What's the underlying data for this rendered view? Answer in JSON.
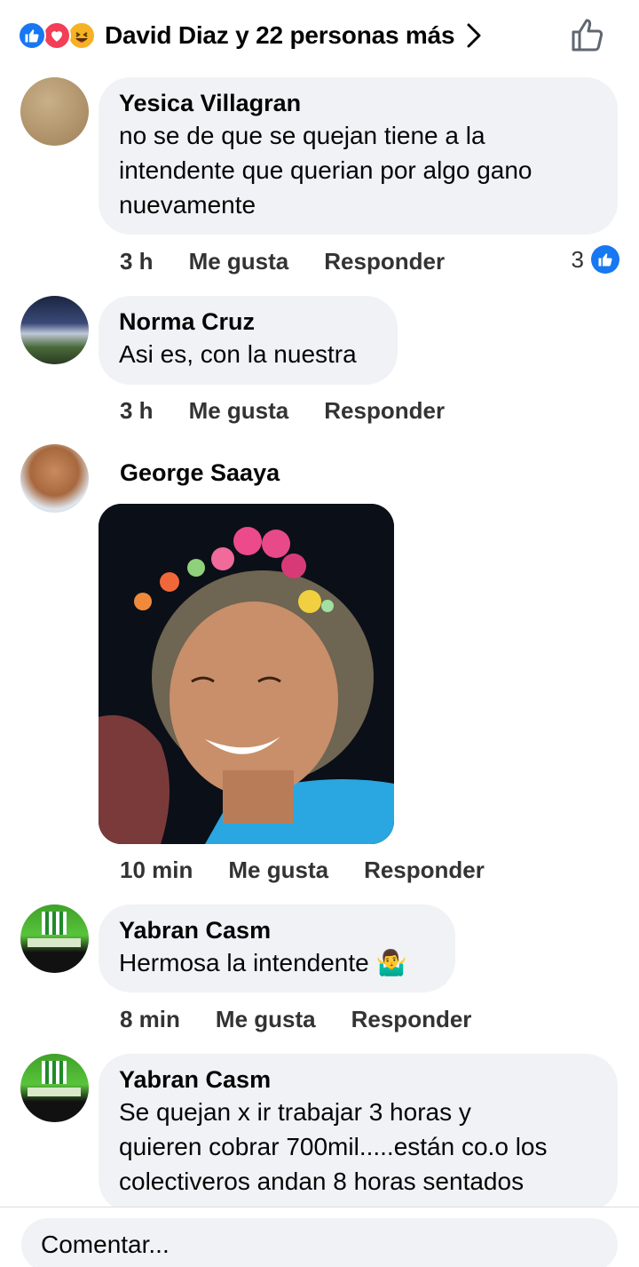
{
  "header": {
    "reactions_summary": "David Diaz y 22 personas más",
    "reaction_types": [
      "like-icon",
      "love-icon",
      "haha-icon"
    ]
  },
  "comments": [
    {
      "author": "Yesica Villagran",
      "text_lines": [
        "no se de que se quejan  tiene a la",
        "intendente que querian por algo gano",
        "nuevamente"
      ],
      "time": "3 h",
      "like_label": "Me gusta",
      "reply_label": "Responder",
      "reaction_count": "3"
    },
    {
      "author": "Norma Cruz",
      "text_lines": [
        "Asi es, con la nuestra"
      ],
      "time": "3 h",
      "like_label": "Me gusta",
      "reply_label": "Responder"
    },
    {
      "author": "George Saaya",
      "attachment": "photo",
      "time": "10 min",
      "like_label": "Me gusta",
      "reply_label": "Responder"
    },
    {
      "author": "Yabran Casm",
      "text_lines": [
        "Hermosa la intendente 🤷‍♂️"
      ],
      "time": "8 min",
      "like_label": "Me gusta",
      "reply_label": "Responder"
    },
    {
      "author": "Yabran Casm",
      "text_lines": [
        "Se quejan x ir trabajar  3 horas y",
        "quieren cobrar 700mil.....están co.o los",
        "colectiveros andan 8 horas sentados"
      ]
    }
  ],
  "composer": {
    "placeholder": "Comentar..."
  },
  "colors": {
    "bubble": "#f0f2f5",
    "like_blue": "#1877f2",
    "love_red": "#f33e58",
    "haha_yellow": "#f7b125"
  }
}
